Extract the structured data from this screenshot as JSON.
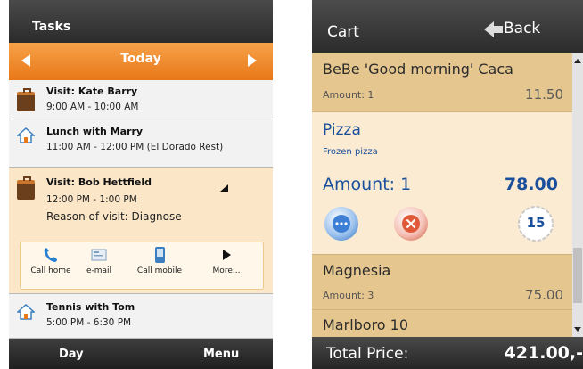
{
  "tasks": {
    "title": "Tasks",
    "day_label": "Today",
    "items": [
      {
        "title": "Visit: Kate Barry",
        "time": "9:00 AM - 10:00 AM",
        "icon": "briefcase-icon"
      },
      {
        "title": "Lunch with Marry",
        "time": "11:00 AM - 12:00 PM (El Dorado Rest)",
        "icon": "house-icon"
      },
      {
        "title": "Visit: Bob Hettfield",
        "time": "12:00 PM - 1:00 PM",
        "reason": "Reason of visit: Diagnose",
        "icon": "briefcase-icon"
      },
      {
        "title": "Tennis with Tom",
        "time": "5:00 PM - 6:30 PM",
        "icon": "house-icon"
      }
    ],
    "actions": [
      {
        "label": "Call home",
        "icon": "phone-icon"
      },
      {
        "label": "e-mail",
        "icon": "email-icon"
      },
      {
        "label": "Call mobile",
        "icon": "mobile-icon"
      },
      {
        "label": "More...",
        "icon": "play-icon"
      }
    ],
    "bottom": {
      "left": "Day",
      "right": "Menu"
    }
  },
  "cart": {
    "title": "Cart",
    "back_label": "Back",
    "items": [
      {
        "name": "BeBe 'Good morning' Caca",
        "amount": "Amount: 1",
        "price": "11.50"
      },
      {
        "name": "Pizza",
        "subtitle": "Frozen pizza",
        "amount": "Amount: 1",
        "price": "78.00",
        "badge": "15"
      },
      {
        "name": "Magnesia",
        "amount": "Amount: 3",
        "price": "75.00"
      },
      {
        "name": "Marlboro 10"
      }
    ],
    "total_label": "Total Price:",
    "total_value": "421.00,-"
  },
  "colors": {
    "orange": "#e87818",
    "cart_row": "#e6c68f",
    "cart_sel": "#fbebd2",
    "blue": "#1a4f9c"
  }
}
